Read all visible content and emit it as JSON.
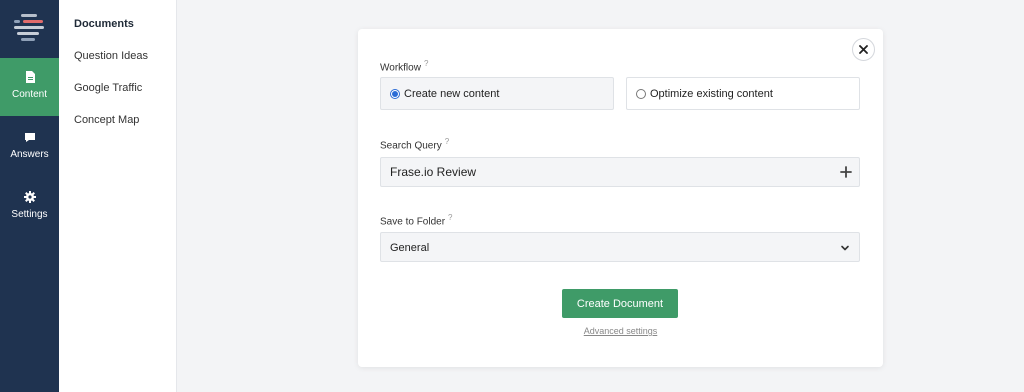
{
  "rail": {
    "items": [
      {
        "label": "Content",
        "icon": "document-icon"
      },
      {
        "label": "Answers",
        "icon": "chat-bubble-icon"
      },
      {
        "label": "Settings",
        "icon": "gear-icon"
      }
    ]
  },
  "subnav": {
    "items": [
      {
        "label": "Documents"
      },
      {
        "label": "Question Ideas"
      },
      {
        "label": "Google Traffic"
      },
      {
        "label": "Concept Map"
      }
    ]
  },
  "modal": {
    "workflow": {
      "label": "Workflow",
      "hint": "?",
      "options": [
        {
          "label": "Create new content",
          "selected": true
        },
        {
          "label": "Optimize existing content",
          "selected": false
        }
      ]
    },
    "search": {
      "label": "Search Query",
      "hint": "?",
      "value": "Frase.io Review"
    },
    "folder": {
      "label": "Save to Folder",
      "hint": "?",
      "value": "General"
    },
    "create_button": "Create Document",
    "advanced_link": "Advanced settings"
  },
  "colors": {
    "rail_bg": "#1f3350",
    "accent_green": "#3f9b68",
    "radio_blue": "#2b6cd6"
  }
}
